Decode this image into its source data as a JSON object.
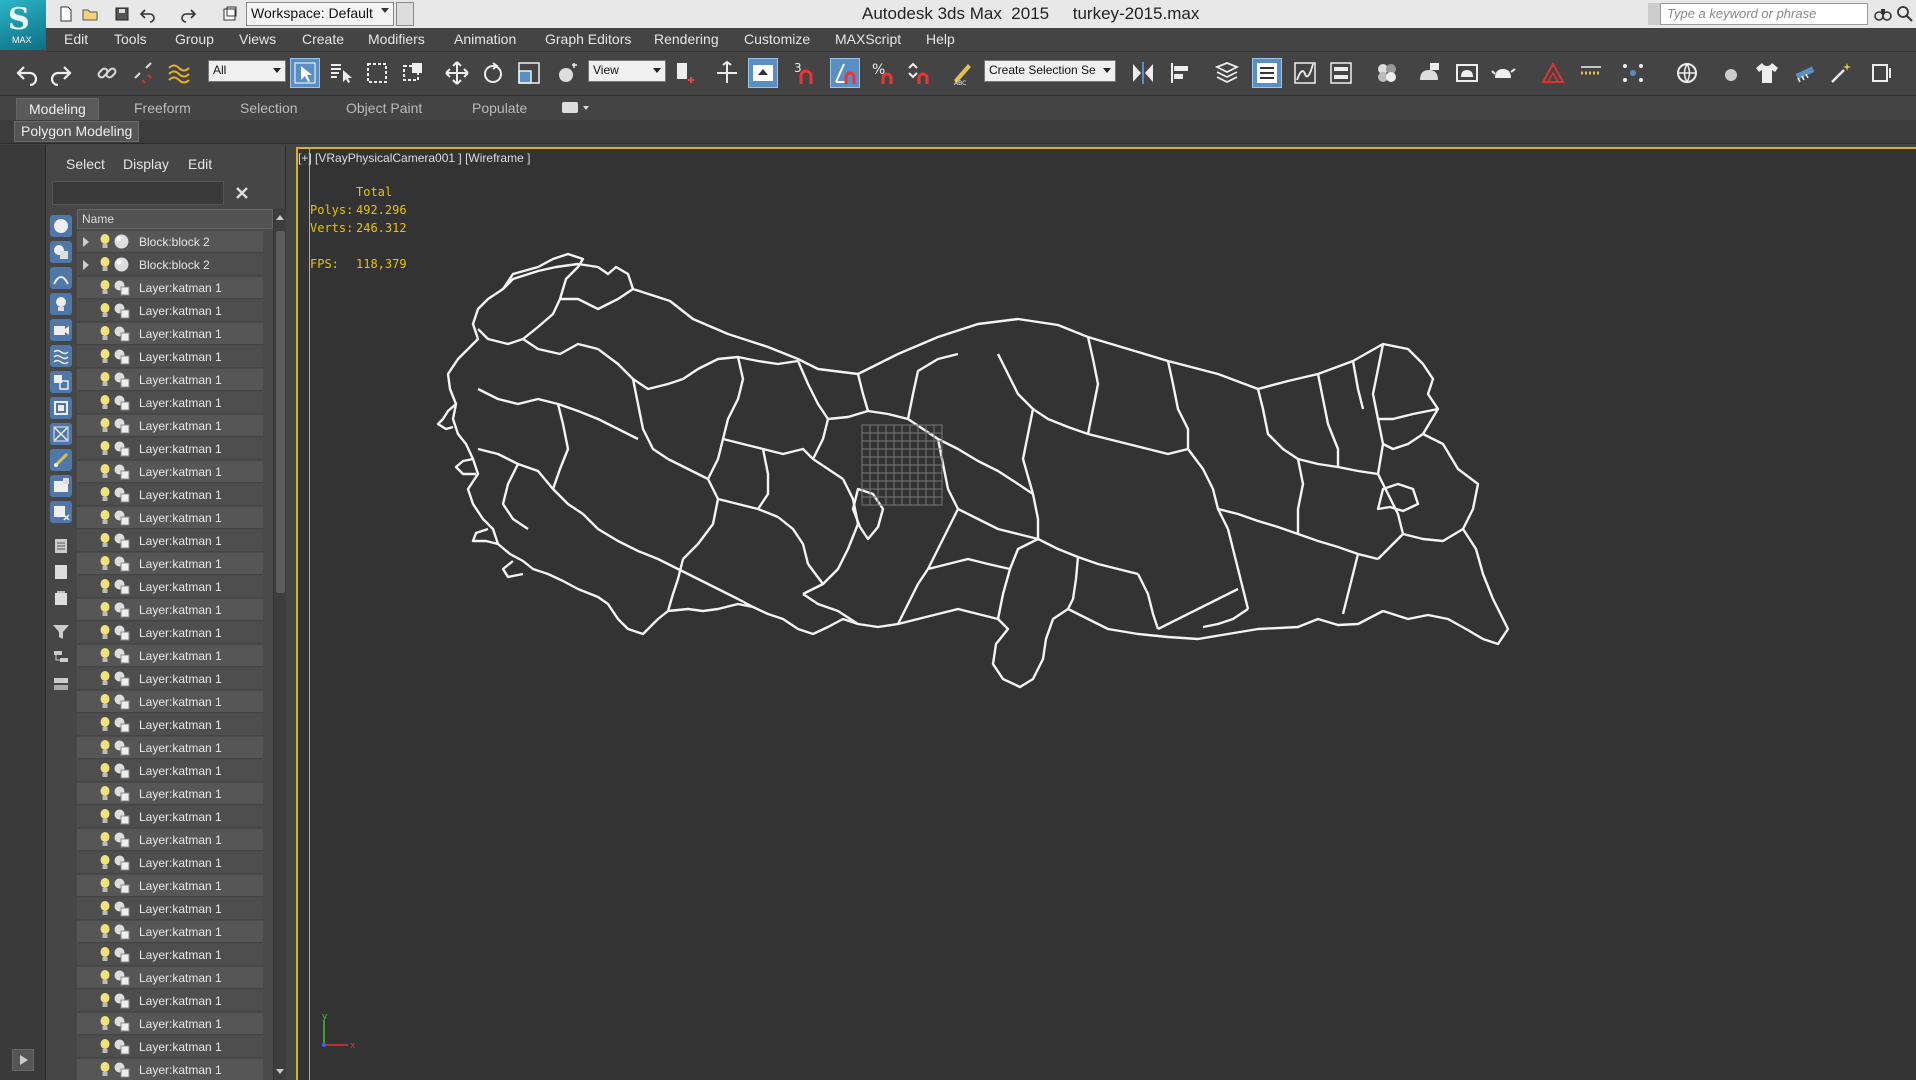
{
  "titlebar": {
    "workspace": "Workspace: Default",
    "title": "Autodesk 3ds Max  2015     turkey-2015.max",
    "search_placeholder": "Type a keyword or phrase",
    "logo_text": "MAX"
  },
  "menu": [
    "Edit",
    "Tools",
    "Group",
    "Views",
    "Create",
    "Modifiers",
    "Animation",
    "Graph Editors",
    "Rendering",
    "Customize",
    "MAXScript",
    "Help"
  ],
  "toolbar": {
    "filter": "All",
    "coord_system": "View",
    "selection_set": "Create Selection Se",
    "snap_number": "3",
    "accent": "#5a8fc4"
  },
  "ribbon": {
    "tabs": [
      "Modeling",
      "Freeform",
      "Selection",
      "Object Paint",
      "Populate"
    ],
    "active_tab": "Modeling",
    "panel": "Polygon Modeling"
  },
  "scene_explorer": {
    "menus": [
      "Select",
      "Display",
      "Edit"
    ],
    "column_header": "Name",
    "rows": [
      {
        "label": "Block:block 2",
        "type": "block",
        "expandable": true
      },
      {
        "label": "Block:block 2",
        "type": "block",
        "expandable": true
      },
      {
        "label": "Layer:katman 1",
        "type": "layer"
      },
      {
        "label": "Layer:katman 1",
        "type": "layer"
      },
      {
        "label": "Layer:katman 1",
        "type": "layer"
      },
      {
        "label": "Layer:katman 1",
        "type": "layer"
      },
      {
        "label": "Layer:katman 1",
        "type": "layer"
      },
      {
        "label": "Layer:katman 1",
        "type": "layer"
      },
      {
        "label": "Layer:katman 1",
        "type": "layer"
      },
      {
        "label": "Layer:katman 1",
        "type": "layer"
      },
      {
        "label": "Layer:katman 1",
        "type": "layer"
      },
      {
        "label": "Layer:katman 1",
        "type": "layer"
      },
      {
        "label": "Layer:katman 1",
        "type": "layer"
      },
      {
        "label": "Layer:katman 1",
        "type": "layer"
      },
      {
        "label": "Layer:katman 1",
        "type": "layer"
      },
      {
        "label": "Layer:katman 1",
        "type": "layer"
      },
      {
        "label": "Layer:katman 1",
        "type": "layer"
      },
      {
        "label": "Layer:katman 1",
        "type": "layer"
      },
      {
        "label": "Layer:katman 1",
        "type": "layer"
      },
      {
        "label": "Layer:katman 1",
        "type": "layer"
      },
      {
        "label": "Layer:katman 1",
        "type": "layer"
      },
      {
        "label": "Layer:katman 1",
        "type": "layer"
      },
      {
        "label": "Layer:katman 1",
        "type": "layer"
      },
      {
        "label": "Layer:katman 1",
        "type": "layer"
      },
      {
        "label": "Layer:katman 1",
        "type": "layer"
      },
      {
        "label": "Layer:katman 1",
        "type": "layer"
      },
      {
        "label": "Layer:katman 1",
        "type": "layer"
      },
      {
        "label": "Layer:katman 1",
        "type": "layer"
      },
      {
        "label": "Layer:katman 1",
        "type": "layer"
      },
      {
        "label": "Layer:katman 1",
        "type": "layer"
      },
      {
        "label": "Layer:katman 1",
        "type": "layer"
      },
      {
        "label": "Layer:katman 1",
        "type": "layer"
      },
      {
        "label": "Layer:katman 1",
        "type": "layer"
      },
      {
        "label": "Layer:katman 1",
        "type": "layer"
      },
      {
        "label": "Layer:katman 1",
        "type": "layer"
      },
      {
        "label": "Layer:katman 1",
        "type": "layer"
      },
      {
        "label": "Layer:katman 1",
        "type": "layer"
      },
      {
        "label": "Layer:katman 1",
        "type": "layer"
      },
      {
        "label": "Layer:katman 1",
        "type": "layer"
      }
    ]
  },
  "viewport": {
    "label": "[+] [VRayPhysicalCamera001 ] [Wireframe ]",
    "stats_header": "Total",
    "polys_label": "Polys:",
    "polys_value": "492.296",
    "verts_label": "Verts:",
    "verts_value": "246.312",
    "fps_label": "FPS:",
    "fps_value": "118,379",
    "border_color": "#d4b12a",
    "stats_color": "#e8c400",
    "axis_x": "x",
    "axis_y": "y"
  }
}
